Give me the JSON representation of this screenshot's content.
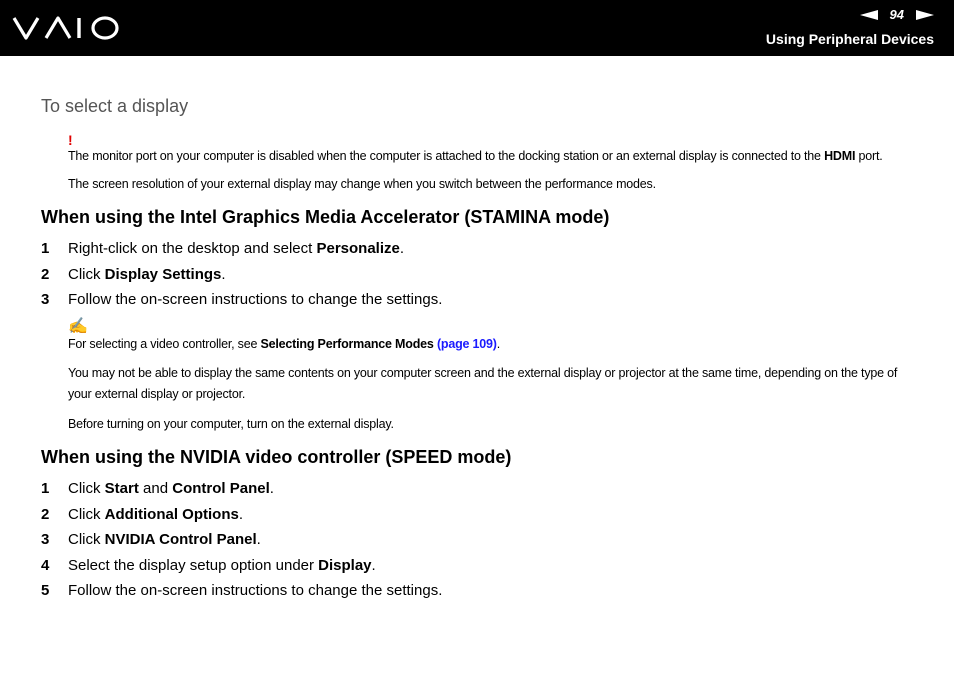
{
  "header": {
    "page_number": "94",
    "section_title": "Using Peripheral Devices"
  },
  "page": {
    "subtitle": "To select a display",
    "warning_mark": "!",
    "warning_text_1": "The monitor port on your computer is disabled when the computer is attached to the docking station or an external display is connected to the ",
    "warning_text_hdmi": "HDMI",
    "warning_text_2": " port.",
    "warning_text_3": "The screen resolution of your external display may change when you switch between the performance modes.",
    "section1": {
      "heading": "When using the Intel Graphics Media Accelerator (STAMINA mode)",
      "steps": [
        {
          "num": "1",
          "pre": "Right-click on the desktop and select ",
          "bold": "Personalize",
          "post": "."
        },
        {
          "num": "2",
          "pre": "Click ",
          "bold": "Display Settings",
          "post": "."
        },
        {
          "num": "3",
          "pre": "Follow the on-screen instructions to change the settings.",
          "bold": "",
          "post": ""
        }
      ]
    },
    "note": {
      "icon": "✍",
      "line1_pre": "For selecting a video controller, see ",
      "line1_bold": "Selecting Performance Modes",
      "line1_link": "(page 109)",
      "line1_post": ".",
      "line2": "You may not be able to display the same contents on your computer screen and the external display or projector at the same time, depending on the type of your external display or projector.",
      "line3": "Before turning on your computer, turn on the external display."
    },
    "section2": {
      "heading": "When using the NVIDIA video controller (SPEED mode)",
      "steps": [
        {
          "num": "1",
          "pre": "Click ",
          "bold": "Start",
          "mid": " and ",
          "bold2": "Control Panel",
          "post": "."
        },
        {
          "num": "2",
          "pre": "Click ",
          "bold": "Additional Options",
          "post": "."
        },
        {
          "num": "3",
          "pre": "Click ",
          "bold": "NVIDIA Control Panel",
          "post": "."
        },
        {
          "num": "4",
          "pre": "Select the display setup option under ",
          "bold": "Display",
          "post": "."
        },
        {
          "num": "5",
          "pre": "Follow the on-screen instructions to change the settings.",
          "bold": "",
          "post": ""
        }
      ]
    }
  }
}
